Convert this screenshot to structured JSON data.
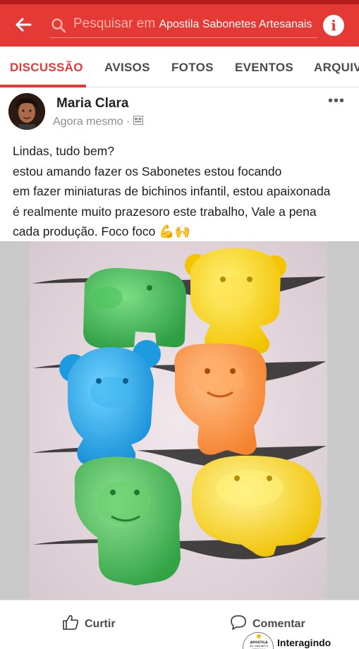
{
  "header": {
    "search_placeholder": "Pesquisar em",
    "group_name": "Apostila Sabonetes Artesanais",
    "accent": "#e53935"
  },
  "tabs": [
    {
      "label": "DISCUSSÃO",
      "active": true
    },
    {
      "label": "AVISOS"
    },
    {
      "label": "FOTOS"
    },
    {
      "label": "EVENTOS"
    },
    {
      "label": "ARQUIV"
    }
  ],
  "post": {
    "author": "Maria Clara",
    "time": "Agora mesmo",
    "lines": [
      "Lindas, tudo bem?",
      "estou amando fazer os Sabonetes estou focando",
      "em fazer miniaturas de bichinos infantil, estou apaixonada",
      "é realmente muito prazesoro este trabalho, Vale a pena",
      "cada produção. Foco foco"
    ],
    "emoji": "💪🙌"
  },
  "actions": {
    "like": "Curtir",
    "comment": "Comentar"
  },
  "badge": {
    "logo_text": "APOSTILA DO SABONETE ARTESANAL",
    "label": "Interagindo"
  }
}
